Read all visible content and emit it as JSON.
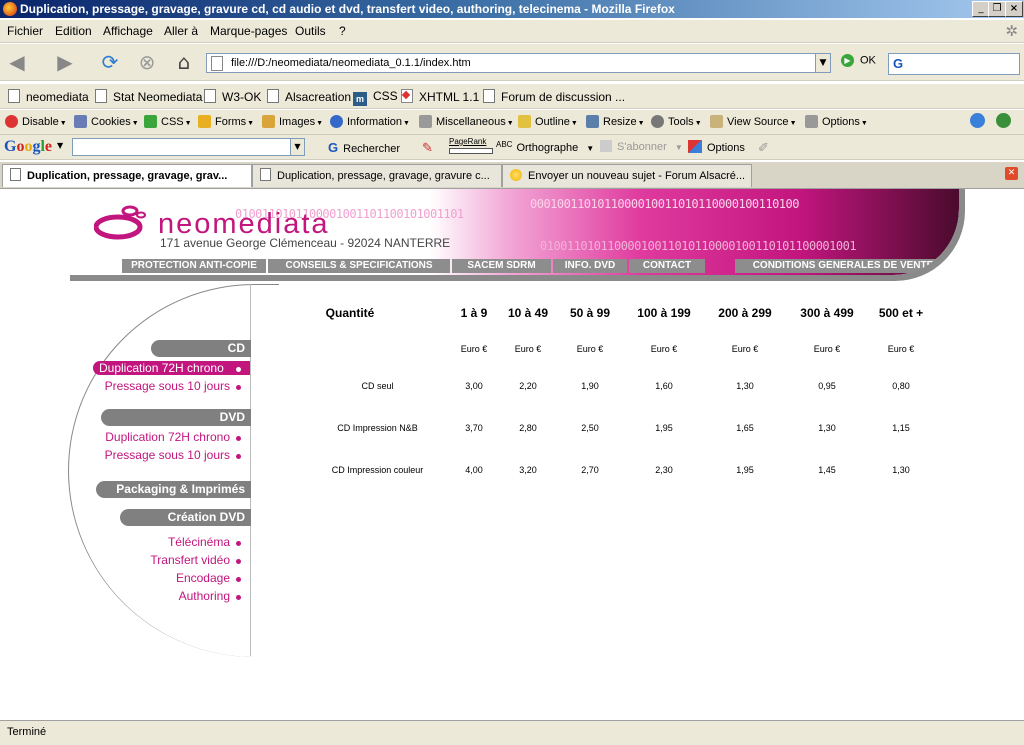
{
  "window": {
    "title": "Duplication, pressage, gravage, gravure cd, cd audio et dvd, transfert video, authoring, telecinema - Mozilla Firefox"
  },
  "menu": [
    "Fichier",
    "Edition",
    "Affichage",
    "Aller à",
    "Marque-pages",
    "Outils",
    "?"
  ],
  "nav": {
    "url": "file:///D:/neomediata/neomediata_0.1.1/index.htm",
    "go_label": "OK"
  },
  "bookmarks": [
    "neomediata",
    "Stat Neomediata",
    "W3-OK",
    "Alsacreation",
    "CSS",
    "XHTML 1.1",
    "Forum de discussion ..."
  ],
  "devtoolbar": [
    "Disable",
    "Cookies",
    "CSS",
    "Forms",
    "Images",
    "Information",
    "Miscellaneous",
    "Outline",
    "Resize",
    "Tools",
    "View Source",
    "Options"
  ],
  "googlebar": {
    "search_label": "Rechercher",
    "pagerank": "PageRank",
    "spell": "Orthographe",
    "subscribe": "S'abonner",
    "options": "Options"
  },
  "tabs": [
    "Duplication, pressage, gravage, grav...",
    "Duplication, pressage, gravage, gravure c...",
    "Envoyer un nouveau sujet - Forum Alsacré..."
  ],
  "site": {
    "logo": "neomediata",
    "address": "171 avenue George Clémenceau - 92024 NANTERRE",
    "binary_a": "0100110101100001001101100101001101",
    "binary_b": "0001001101011000010011010110000100110100",
    "binary_c": "01001101011000010011010110000100110101100001001",
    "topnav": [
      "PROTECTION ANTI-COPIE",
      "CONSEILS & SPECIFICATIONS",
      "SACEM SDRM",
      "INFO. DVD",
      "CONTACT",
      "CONDITIONS GENERALES DE VENTE"
    ]
  },
  "sidebar": {
    "cd": {
      "title": "CD",
      "items": [
        "Duplication 72H chrono",
        "Pressage sous 10 jours"
      ]
    },
    "dvd": {
      "title": "DVD",
      "items": [
        "Duplication 72H chrono",
        "Pressage sous 10 jours"
      ]
    },
    "packaging": {
      "title": "Packaging & Imprimés"
    },
    "creation": {
      "title": "Création DVD",
      "items": [
        "Télécinéma",
        "Transfert vidéo",
        "Encodage",
        "Authoring"
      ]
    }
  },
  "prices": {
    "headers": [
      "Quantité",
      "1 à 9",
      "10 à 49",
      "50 à 99",
      "100 à 199",
      "200 à 299",
      "300 à 499",
      "500 et +"
    ],
    "currency": "Euro €",
    "rows": [
      {
        "label": "CD seul",
        "values": [
          "3,00",
          "2,20",
          "1,90",
          "1,60",
          "1,30",
          "0,95",
          "0,80"
        ]
      },
      {
        "label": "CD Impression N&B",
        "values": [
          "3,70",
          "2,80",
          "2,50",
          "1,95",
          "1,65",
          "1,30",
          "1,15"
        ]
      },
      {
        "label": "CD Impression couleur",
        "values": [
          "4,00",
          "3,20",
          "2,70",
          "2,30",
          "1,95",
          "1,45",
          "1,30"
        ]
      }
    ]
  },
  "status": "Terminé",
  "colors": {
    "brand": "#c2157e",
    "nav_gray": "#8d8d8d"
  }
}
